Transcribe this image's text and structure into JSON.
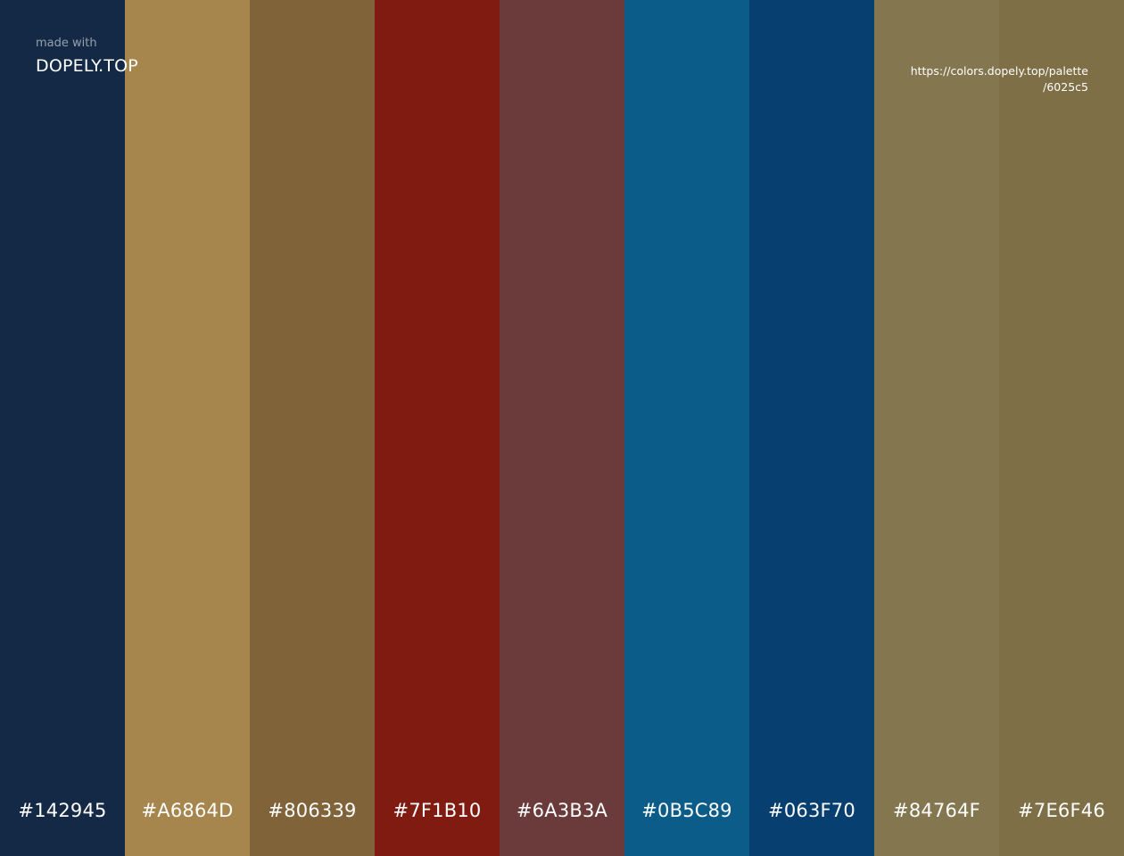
{
  "brand": {
    "caption": "made with",
    "name": "DOPELY.TOP"
  },
  "link": {
    "line1": "https://colors.dopely.top/palette",
    "line2": "/6025c5"
  },
  "swatches": [
    {
      "hex": "#142945",
      "color": "#142945"
    },
    {
      "hex": "#A6864D",
      "color": "#A6864D"
    },
    {
      "hex": "#806339",
      "color": "#806339"
    },
    {
      "hex": "#7F1B10",
      "color": "#7F1B10"
    },
    {
      "hex": "#6A3B3A",
      "color": "#6A3B3A"
    },
    {
      "hex": "#0B5C89",
      "color": "#0B5C89"
    },
    {
      "hex": "#063F70",
      "color": "#063F70"
    },
    {
      "hex": "#84764F",
      "color": "#84764F"
    },
    {
      "hex": "#7E6F46",
      "color": "#7E6F46"
    }
  ]
}
